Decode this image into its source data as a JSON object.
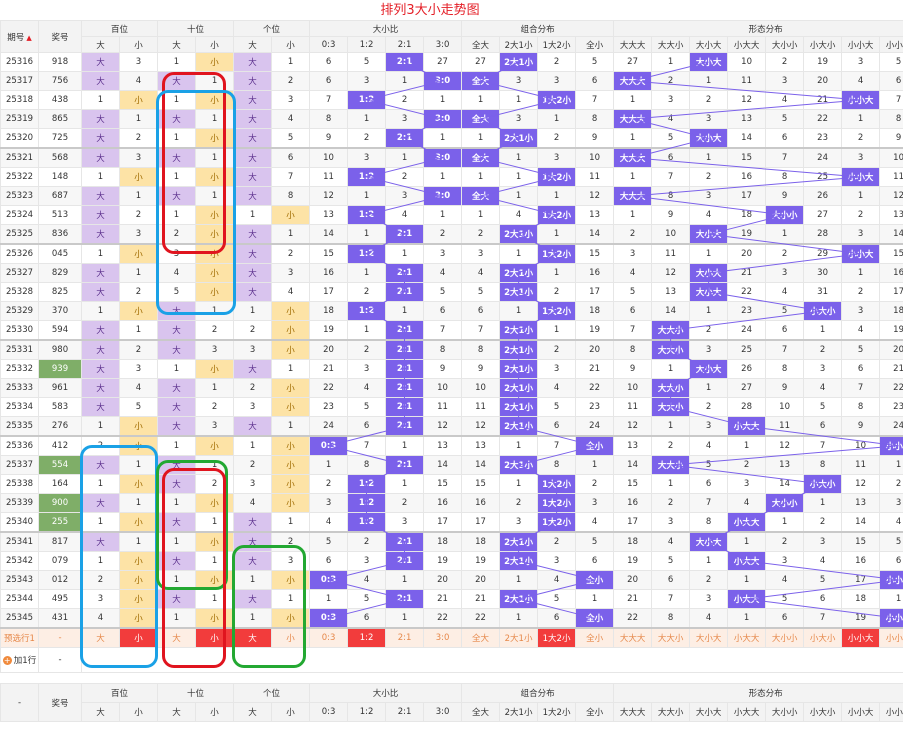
{
  "title": "排列3大小走势图",
  "headers": {
    "issue": "期号",
    "prize": "奖号",
    "groups": [
      {
        "name": "百位",
        "cols": [
          "大",
          "小"
        ]
      },
      {
        "name": "十位",
        "cols": [
          "大",
          "小"
        ]
      },
      {
        "name": "个位",
        "cols": [
          "大",
          "小"
        ]
      },
      {
        "name": "大小比",
        "cols": [
          "0:3",
          "1:2",
          "2:1",
          "3:0"
        ]
      },
      {
        "name": "组合分布",
        "cols": [
          "全大",
          "2大1小",
          "1大2小",
          "全小"
        ]
      },
      {
        "name": "形态分布",
        "cols": [
          "大大大",
          "大大小",
          "大小大",
          "小大大",
          "大小小",
          "小大小",
          "小小大",
          "小小小"
        ]
      }
    ]
  },
  "rows": [
    {
      "id": "25316",
      "prize": "918",
      "green": false,
      "d": [
        "大",
        "3",
        "1",
        "小",
        "大",
        "1",
        "6",
        "5",
        "2:1",
        "27",
        "27",
        "2大1小",
        "2",
        "5",
        "27",
        "1",
        "大小大",
        "10",
        "2",
        "19",
        "3",
        "5"
      ]
    },
    {
      "id": "25317",
      "prize": "756",
      "green": false,
      "d": [
        "大",
        "4",
        "大",
        "1",
        "大",
        "2",
        "6",
        "3",
        "1",
        "3:0",
        "全大",
        "3",
        "3",
        "6",
        "大大大",
        "2",
        "1",
        "11",
        "3",
        "20",
        "4",
        "6"
      ]
    },
    {
      "id": "25318",
      "prize": "438",
      "green": false,
      "d": [
        "1",
        "小",
        "1",
        "小",
        "大",
        "3",
        "7",
        "1:2",
        "2",
        "1",
        "1",
        "1",
        "1大2小",
        "7",
        "1",
        "3",
        "2",
        "12",
        "4",
        "21",
        "小小大",
        "7"
      ]
    },
    {
      "id": "25319",
      "prize": "865",
      "green": false,
      "d": [
        "大",
        "1",
        "大",
        "1",
        "大",
        "4",
        "8",
        "1",
        "3",
        "3:0",
        "全大",
        "3",
        "1",
        "8",
        "大大大",
        "4",
        "3",
        "13",
        "5",
        "22",
        "1",
        "8"
      ]
    },
    {
      "id": "25320",
      "prize": "725",
      "green": false,
      "d": [
        "大",
        "2",
        "1",
        "小",
        "大",
        "5",
        "9",
        "2",
        "2:1",
        "1",
        "1",
        "2大1小",
        "2",
        "9",
        "1",
        "5",
        "大小大",
        "14",
        "6",
        "23",
        "2",
        "9"
      ]
    },
    {
      "id": "25321",
      "prize": "568",
      "green": false,
      "d": [
        "大",
        "3",
        "大",
        "1",
        "大",
        "6",
        "10",
        "3",
        "1",
        "3:0",
        "全大",
        "1",
        "3",
        "10",
        "大大大",
        "6",
        "1",
        "15",
        "7",
        "24",
        "3",
        "10"
      ]
    },
    {
      "id": "25322",
      "prize": "148",
      "green": false,
      "d": [
        "1",
        "小",
        "1",
        "小",
        "大",
        "7",
        "11",
        "1:2",
        "2",
        "1",
        "1",
        "1",
        "1大2小",
        "11",
        "1",
        "7",
        "2",
        "16",
        "8",
        "25",
        "小小大",
        "11"
      ]
    },
    {
      "id": "25323",
      "prize": "687",
      "green": false,
      "d": [
        "大",
        "1",
        "大",
        "1",
        "大",
        "8",
        "12",
        "1",
        "3",
        "3:0",
        "全大",
        "1",
        "1",
        "12",
        "大大大",
        "8",
        "3",
        "17",
        "9",
        "26",
        "1",
        "12"
      ]
    },
    {
      "id": "25324",
      "prize": "513",
      "green": false,
      "d": [
        "大",
        "2",
        "1",
        "小",
        "1",
        "小",
        "13",
        "1:2",
        "4",
        "1",
        "1",
        "4",
        "1大2小",
        "13",
        "1",
        "9",
        "4",
        "18",
        "大小小",
        "27",
        "2",
        "13"
      ]
    },
    {
      "id": "25325",
      "prize": "836",
      "green": false,
      "d": [
        "大",
        "3",
        "2",
        "小",
        "大",
        "1",
        "14",
        "1",
        "2:1",
        "2",
        "2",
        "2大1小",
        "1",
        "14",
        "2",
        "10",
        "大小大",
        "19",
        "1",
        "28",
        "3",
        "14"
      ]
    },
    {
      "id": "25326",
      "prize": "045",
      "green": false,
      "d": [
        "1",
        "小",
        "3",
        "小",
        "大",
        "2",
        "15",
        "1:2",
        "1",
        "3",
        "3",
        "1",
        "1大2小",
        "15",
        "3",
        "11",
        "1",
        "20",
        "2",
        "29",
        "小小大",
        "15"
      ]
    },
    {
      "id": "25327",
      "prize": "829",
      "green": false,
      "d": [
        "大",
        "1",
        "4",
        "小",
        "大",
        "3",
        "16",
        "1",
        "2:1",
        "4",
        "4",
        "2大1小",
        "1",
        "16",
        "4",
        "12",
        "大小大",
        "21",
        "3",
        "30",
        "1",
        "16"
      ]
    },
    {
      "id": "25328",
      "prize": "825",
      "green": false,
      "d": [
        "大",
        "2",
        "5",
        "小",
        "大",
        "4",
        "17",
        "2",
        "2:1",
        "5",
        "5",
        "2大1小",
        "2",
        "17",
        "5",
        "13",
        "大小大",
        "22",
        "4",
        "31",
        "2",
        "17"
      ]
    },
    {
      "id": "25329",
      "prize": "370",
      "green": false,
      "d": [
        "1",
        "小",
        "大",
        "1",
        "1",
        "小",
        "18",
        "1:2",
        "1",
        "6",
        "6",
        "1",
        "1大2小",
        "18",
        "6",
        "14",
        "1",
        "23",
        "5",
        "小大小",
        "3",
        "18"
      ]
    },
    {
      "id": "25330",
      "prize": "594",
      "green": false,
      "d": [
        "大",
        "1",
        "大",
        "2",
        "2",
        "小",
        "19",
        "1",
        "2:1",
        "7",
        "7",
        "2大1小",
        "1",
        "19",
        "7",
        "大大小",
        "2",
        "24",
        "6",
        "1",
        "4",
        "19"
      ]
    },
    {
      "id": "25331",
      "prize": "980",
      "green": false,
      "d": [
        "大",
        "2",
        "大",
        "3",
        "3",
        "小",
        "20",
        "2",
        "2:1",
        "8",
        "8",
        "2大1小",
        "2",
        "20",
        "8",
        "大大小",
        "3",
        "25",
        "7",
        "2",
        "5",
        "20"
      ]
    },
    {
      "id": "25332",
      "prize": "939",
      "green": true,
      "d": [
        "大",
        "3",
        "1",
        "小",
        "大",
        "1",
        "21",
        "3",
        "2:1",
        "9",
        "9",
        "2大1小",
        "3",
        "21",
        "9",
        "1",
        "大小大",
        "26",
        "8",
        "3",
        "6",
        "21"
      ]
    },
    {
      "id": "25333",
      "prize": "961",
      "green": false,
      "d": [
        "大",
        "4",
        "大",
        "1",
        "2",
        "小",
        "22",
        "4",
        "2:1",
        "10",
        "10",
        "2大1小",
        "4",
        "22",
        "10",
        "大大小",
        "1",
        "27",
        "9",
        "4",
        "7",
        "22"
      ]
    },
    {
      "id": "25334",
      "prize": "583",
      "green": false,
      "d": [
        "大",
        "5",
        "大",
        "2",
        "3",
        "小",
        "23",
        "5",
        "2:1",
        "11",
        "11",
        "2大1小",
        "5",
        "23",
        "11",
        "大大小",
        "2",
        "28",
        "10",
        "5",
        "8",
        "23"
      ]
    },
    {
      "id": "25335",
      "prize": "276",
      "green": false,
      "d": [
        "1",
        "小",
        "大",
        "3",
        "大",
        "1",
        "24",
        "6",
        "2:1",
        "12",
        "12",
        "2大1小",
        "6",
        "24",
        "12",
        "1",
        "3",
        "小大大",
        "11",
        "6",
        "9",
        "24"
      ]
    },
    {
      "id": "25336",
      "prize": "412",
      "green": false,
      "d": [
        "2",
        "小",
        "1",
        "小",
        "1",
        "小",
        "0:3",
        "7",
        "1",
        "13",
        "13",
        "1",
        "7",
        "全小",
        "13",
        "2",
        "4",
        "1",
        "12",
        "7",
        "10",
        "小小小"
      ]
    },
    {
      "id": "25337",
      "prize": "554",
      "green": true,
      "d": [
        "大",
        "1",
        "大",
        "1",
        "2",
        "小",
        "1",
        "8",
        "2:1",
        "14",
        "14",
        "2大1小",
        "8",
        "1",
        "14",
        "大大小",
        "5",
        "2",
        "13",
        "8",
        "11",
        "1"
      ]
    },
    {
      "id": "25338",
      "prize": "164",
      "green": false,
      "d": [
        "1",
        "小",
        "大",
        "2",
        "3",
        "小",
        "2",
        "1:2",
        "1",
        "15",
        "15",
        "1",
        "1大2小",
        "2",
        "15",
        "1",
        "6",
        "3",
        "14",
        "小大小",
        "12",
        "2"
      ]
    },
    {
      "id": "25339",
      "prize": "900",
      "green": true,
      "d": [
        "大",
        "1",
        "1",
        "小",
        "4",
        "小",
        "3",
        "1:2",
        "2",
        "16",
        "16",
        "2",
        "1大2小",
        "3",
        "16",
        "2",
        "7",
        "4",
        "大小小",
        "1",
        "13",
        "3"
      ]
    },
    {
      "id": "25340",
      "prize": "255",
      "green": true,
      "d": [
        "1",
        "小",
        "大",
        "1",
        "大",
        "1",
        "4",
        "1:2",
        "3",
        "17",
        "17",
        "3",
        "1大2小",
        "4",
        "17",
        "3",
        "8",
        "小大大",
        "1",
        "2",
        "14",
        "4"
      ]
    },
    {
      "id": "25341",
      "prize": "817",
      "green": false,
      "d": [
        "大",
        "1",
        "1",
        "小",
        "大",
        "2",
        "5",
        "2",
        "2:1",
        "18",
        "18",
        "2大1小",
        "2",
        "5",
        "18",
        "4",
        "大小大",
        "1",
        "2",
        "3",
        "15",
        "5"
      ]
    },
    {
      "id": "25342",
      "prize": "079",
      "green": false,
      "d": [
        "1",
        "小",
        "大",
        "1",
        "大",
        "3",
        "6",
        "3",
        "2:1",
        "19",
        "19",
        "2大1小",
        "3",
        "6",
        "19",
        "5",
        "1",
        "小大大",
        "3",
        "4",
        "16",
        "6"
      ]
    },
    {
      "id": "25343",
      "prize": "012",
      "green": false,
      "d": [
        "2",
        "小",
        "1",
        "小",
        "1",
        "小",
        "0:3",
        "4",
        "1",
        "20",
        "20",
        "1",
        "4",
        "全小",
        "20",
        "6",
        "2",
        "1",
        "4",
        "5",
        "17",
        "小小小"
      ]
    },
    {
      "id": "25344",
      "prize": "495",
      "green": false,
      "d": [
        "3",
        "小",
        "大",
        "1",
        "大",
        "1",
        "1",
        "5",
        "2:1",
        "21",
        "21",
        "2大1小",
        "5",
        "1",
        "21",
        "7",
        "3",
        "小大大",
        "5",
        "6",
        "18",
        "1"
      ]
    },
    {
      "id": "25345",
      "prize": "431",
      "green": false,
      "d": [
        "4",
        "小",
        "1",
        "小",
        "1",
        "小",
        "0:3",
        "6",
        "1",
        "22",
        "22",
        "1",
        "6",
        "全小",
        "22",
        "8",
        "4",
        "1",
        "6",
        "7",
        "19",
        "小小小"
      ]
    }
  ],
  "preselect": {
    "label": "预选行1",
    "dash": "-",
    "cells": [
      "大",
      "小",
      "大",
      "小",
      "大",
      "小",
      "0:3",
      "1:2",
      "2:1",
      "3:0",
      "全大",
      "2大1小",
      "1大2小",
      "全小",
      "大大大",
      "大大小",
      "大小大",
      "小大大",
      "大小小",
      "小大小",
      "小小大",
      "小小小"
    ]
  },
  "add_row": {
    "label": "加1行",
    "dash": "-"
  },
  "footer": {
    "dash": "-",
    "prize": "奖号"
  },
  "colors": {
    "big": "#d9c4ee",
    "small": "#fde3a6",
    "mark": "#7b61ea",
    "title": "#e41e26",
    "red_box": "#e0141e",
    "blue_box": "#1aa1e6",
    "green_box": "#23a832"
  }
}
